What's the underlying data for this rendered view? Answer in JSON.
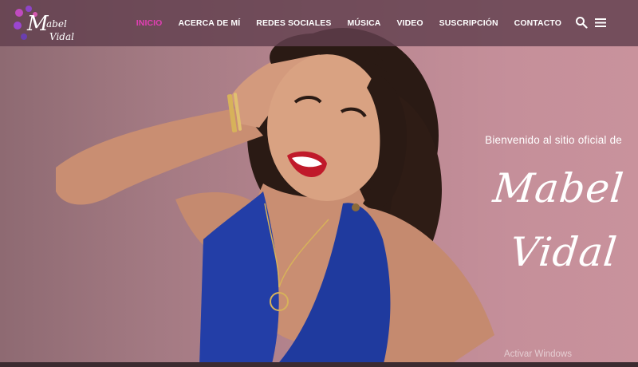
{
  "site": {
    "logo": {
      "monogram": "M",
      "line1": "Mabel",
      "line2": "Vidal"
    }
  },
  "nav": {
    "items": [
      {
        "label": "INICIO",
        "active": true
      },
      {
        "label": "ACERCA DE MÍ",
        "active": false
      },
      {
        "label": "REDES SOCIALES",
        "active": false
      },
      {
        "label": "MÚSICA",
        "active": false
      },
      {
        "label": "VIDEO",
        "active": false
      },
      {
        "label": "SUSCRIPCIÓN",
        "active": false
      },
      {
        "label": "CONTACTO",
        "active": false
      }
    ],
    "icons": [
      "search-icon",
      "hamburger-menu-icon"
    ]
  },
  "hero": {
    "welcome": "Bienvenido al sitio oficial de",
    "name": "Mabel Vidal"
  },
  "system": {
    "watermark": "Activar Windows"
  },
  "colors": {
    "nav_bg": "#62404e",
    "nav_active": "#e23fb4",
    "hero_bg": "#b98791",
    "dress": "#1f3a9e"
  }
}
